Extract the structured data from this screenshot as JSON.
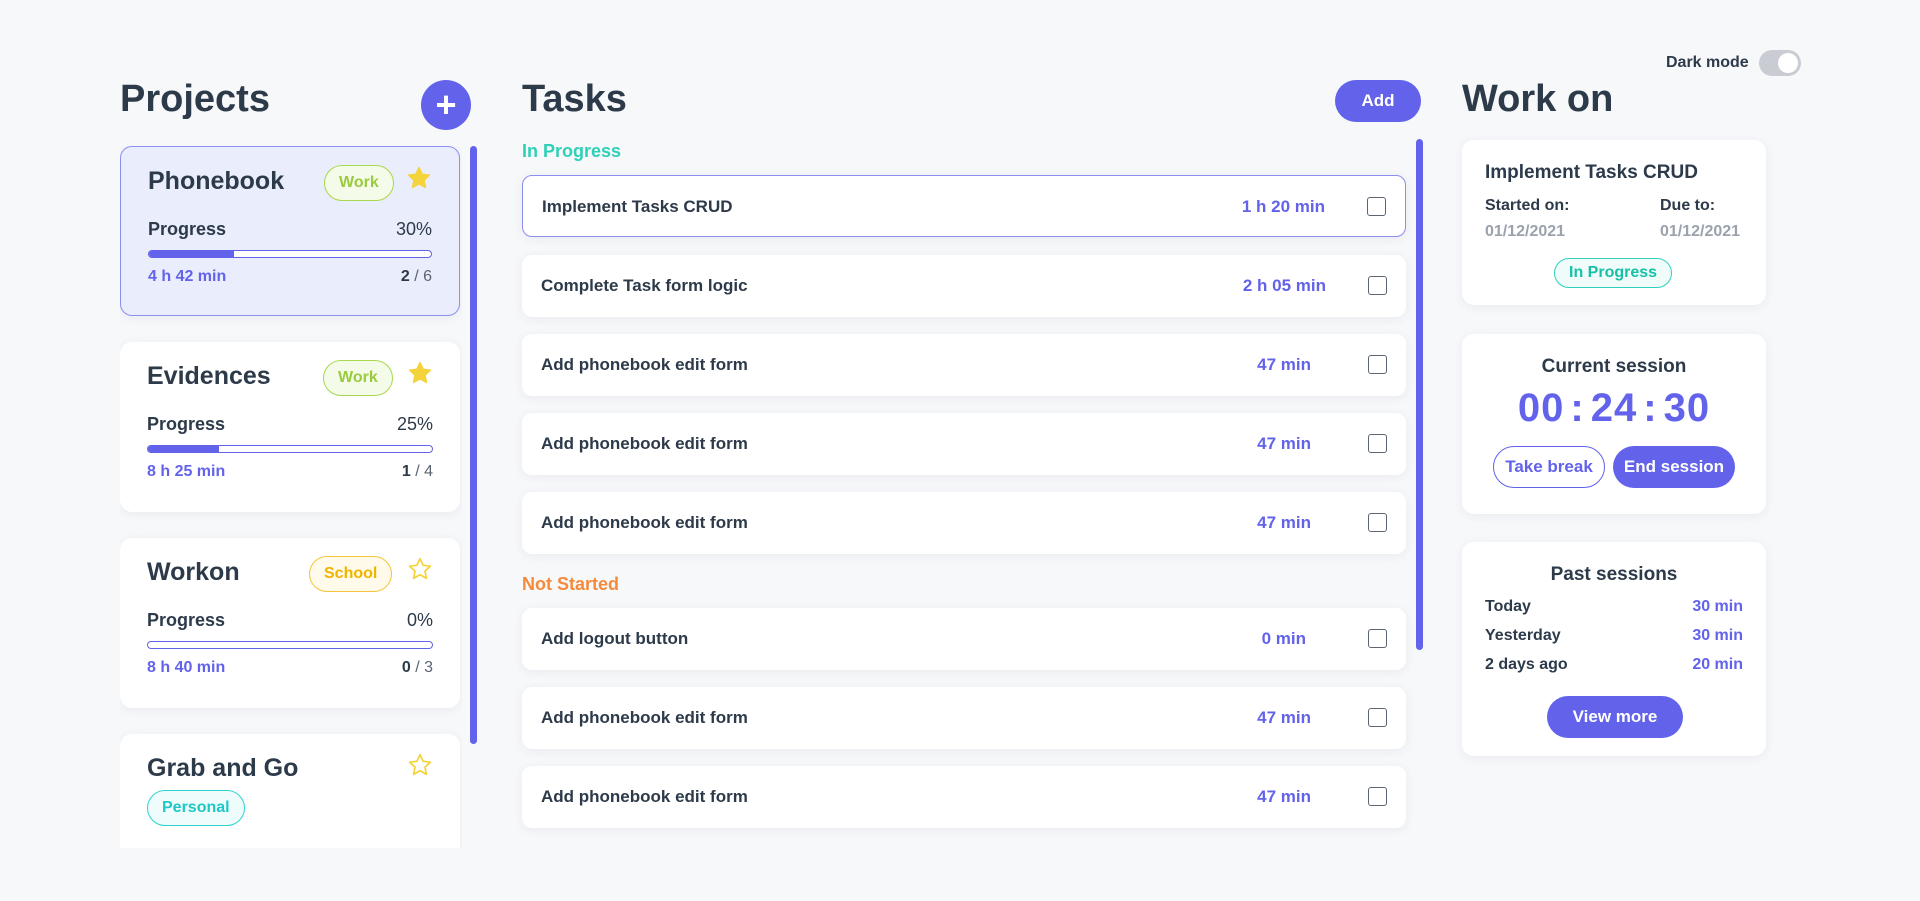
{
  "header": {
    "dark_mode_label": "Dark mode",
    "dark_mode_on": false
  },
  "projects": {
    "title": "Projects",
    "add_symbol": "+",
    "items": [
      {
        "name": "Phonebook",
        "tag": "Work",
        "starred": true,
        "progress_label": "Progress",
        "progress_pct": "30%",
        "progress_value": 0.3,
        "time": "4 h 42 min",
        "done": "2",
        "total": "/ 6",
        "active": true
      },
      {
        "name": "Evidences",
        "tag": "Work",
        "starred": true,
        "progress_label": "Progress",
        "progress_pct": "25%",
        "progress_value": 0.25,
        "time": "8 h 25 min",
        "done": "1",
        "total": "/ 4"
      },
      {
        "name": "Workon",
        "tag": "School",
        "starred": false,
        "progress_label": "Progress",
        "progress_pct": "0%",
        "progress_value": 0.0,
        "time": "8 h 40 min",
        "done": "0",
        "total": "/ 3"
      },
      {
        "name": "Grab and Go",
        "tag": "Personal",
        "starred": false
      }
    ]
  },
  "tasks": {
    "title": "Tasks",
    "add_label": "Add",
    "in_progress_label": "In Progress",
    "not_started_label": "Not Started",
    "in_progress": [
      {
        "name": "Implement Tasks CRUD",
        "time": "1 h 20 min",
        "active": true
      },
      {
        "name": "Complete Task form logic",
        "time": "2 h 05 min"
      },
      {
        "name": "Add phonebook edit form",
        "time": "47 min"
      },
      {
        "name": "Add phonebook edit form",
        "time": "47 min"
      },
      {
        "name": "Add phonebook edit form",
        "time": "47 min"
      }
    ],
    "not_started": [
      {
        "name": "Add logout button",
        "time": "0 min"
      },
      {
        "name": "Add phonebook edit form",
        "time": "47 min"
      },
      {
        "name": "Add phonebook edit form",
        "time": "47 min"
      }
    ]
  },
  "workon": {
    "title": "Work on",
    "task": {
      "name": "Implement Tasks CRUD",
      "started_label": "Started on:",
      "started_value": "01/12/2021",
      "due_label": "Due to:",
      "due_value": "01/12/2021",
      "status": "In Progress"
    },
    "session": {
      "title": "Current session",
      "hh": "00",
      "mm": "24",
      "ss": "30",
      "take_break_label": "Take break",
      "end_session_label": "End session"
    },
    "past": {
      "title": "Past sessions",
      "rows": [
        {
          "day": "Today",
          "duration": "30 min"
        },
        {
          "day": "Yesterday",
          "duration": "30 min"
        },
        {
          "day": "2 days ago",
          "duration": "20 min"
        }
      ],
      "view_more_label": "View more"
    }
  },
  "colors": {
    "accent": "#6262eb",
    "in_progress": "#2ed1b8",
    "not_started": "#f58a3c",
    "star": "#f5d33b",
    "tag_work": "#9acb3e",
    "tag_school": "#f0b400",
    "tag_personal": "#1fc7c7"
  },
  "icons": {
    "add_project": "plus-icon",
    "favorite": "star-icon",
    "task_checkbox": "checkbox-icon"
  }
}
